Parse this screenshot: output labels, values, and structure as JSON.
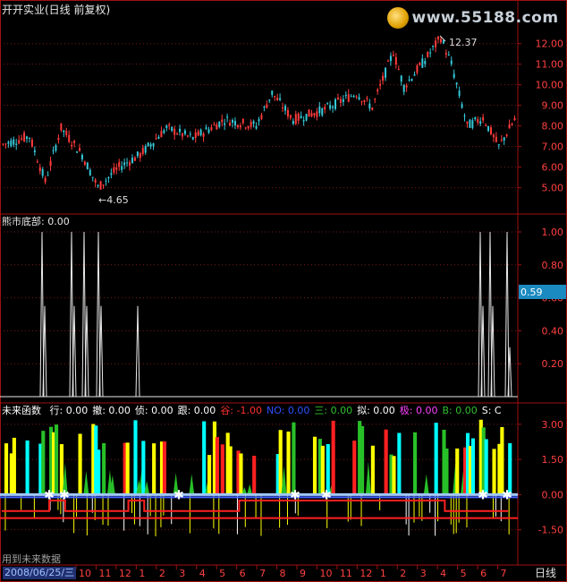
{
  "colors": {
    "background": "#000000",
    "grid": "#7a1a1a",
    "axis_border": "#a01010",
    "up_candle": "#ff3b3b",
    "down_candle": "#35c8d8",
    "white_line": "#e8e8e8",
    "yellow": "#ffff00",
    "cyan": "#00ffff",
    "green": "#28c028",
    "red": "#ff2020",
    "magenta": "#ff40ff",
    "blue": "#4060ff",
    "highlight_label": "#1a8ac0"
  },
  "panel_price": {
    "title": "开开实业(日线 前复权)",
    "watermark": "www.55188.com",
    "y_ticks": [
      "12.00",
      "11.00",
      "10.00",
      "9.00",
      "8.00",
      "7.00",
      "6.00",
      "5.00"
    ],
    "high_marker": "12.37",
    "low_marker": "4.65"
  },
  "panel_indicator": {
    "title": "熊市底部",
    "value": ": 0.00",
    "y_ticks": [
      "1.00",
      "0.80",
      "0.60",
      "0.40",
      "0.20"
    ],
    "current_label": "0.59"
  },
  "panel_future": {
    "title": "未来函数",
    "fields": [
      {
        "label": "行",
        "value": ": 0.00",
        "color": "#ffffff"
      },
      {
        "label": "撤",
        "value": ": 0.00",
        "color": "#ffffff"
      },
      {
        "label": "侦",
        "value": ": 0.00",
        "color": "#ffffff"
      },
      {
        "label": "跟",
        "value": ": 0.00",
        "color": "#ffffff"
      },
      {
        "label": "谷",
        "value": ": -1.00",
        "color": "#ff3030"
      },
      {
        "label": "NO",
        "value": ": 0.00",
        "color": "#3050ff"
      },
      {
        "label": "三",
        "value": ": 0.00",
        "color": "#30c030"
      },
      {
        "label": "拟",
        "value": ": 0.00",
        "color": "#ffffff"
      },
      {
        "label": "极",
        "value": ": 0.00",
        "color": "#ff40ff"
      },
      {
        "label": "B",
        "value": ": 0.00",
        "color": "#30c030"
      },
      {
        "label": "S",
        "value": ": C",
        "color": "#ffffff"
      }
    ],
    "y_ticks": [
      "3.00",
      "1.50",
      "0.00",
      "-1.50"
    ],
    "note": "用到未来数据"
  },
  "bottom_bar": {
    "date": "2008/06/25/三",
    "months": [
      "10",
      "11",
      "12",
      "1",
      "2",
      "3",
      "4",
      "5",
      "6",
      "7",
      "8",
      "9",
      "10",
      "11",
      "12",
      "1",
      "2",
      "3",
      "4",
      "5",
      "6",
      "7"
    ],
    "period_button": "日线"
  }
}
